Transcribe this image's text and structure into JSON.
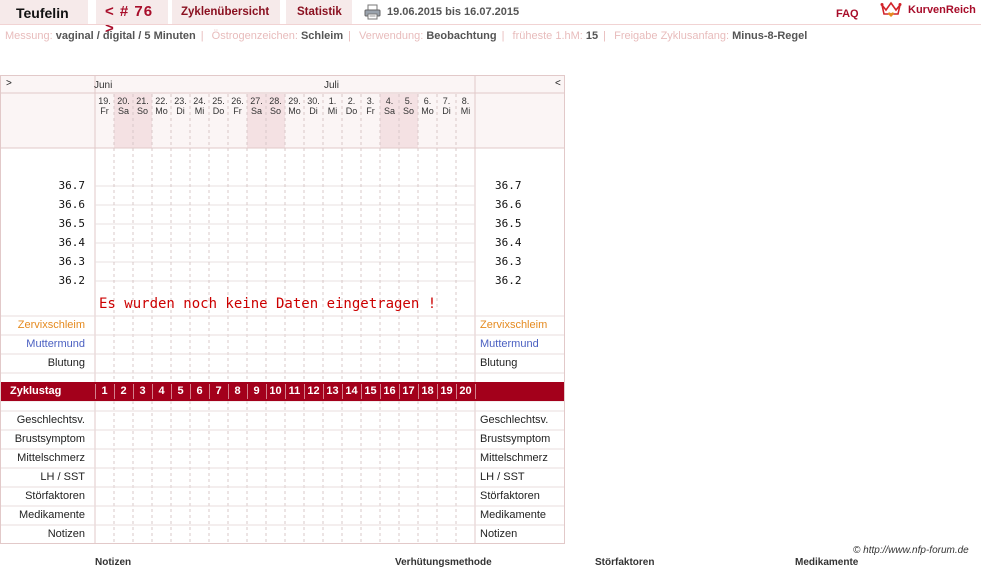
{
  "header": {
    "username": "Teufelin",
    "cycle_nav": "< # 76 >",
    "tab_overview": "Zyklenübersicht",
    "tab_stats": "Statistik",
    "date_range": "19.06.2015 bis 16.07.2015",
    "faq": "FAQ",
    "logo": "KurvenReich",
    "printer_icon": "printer-icon",
    "logo_icon": "crown-heart-icon"
  },
  "meta": {
    "messung_label": "Messung:",
    "messung_value": "vaginal / digital / 5 Minuten",
    "oestrogen_label": "Östrogenzeichen:",
    "oestrogen_value": "Schleim",
    "verwendung_label": "Verwendung:",
    "verwendung_value": "Beobachtung",
    "fruehste_label": "früheste 1.hM:",
    "fruehste_value": "15",
    "freigabe_label": "Freigabe Zyklusanfang:",
    "freigabe_value": "Minus-8-Regel"
  },
  "chart": {
    "nav_left": ">",
    "nav_right": "<",
    "months": [
      "Juni",
      "Juli"
    ],
    "days": [
      {
        "n": "19.",
        "d": "Fr",
        "we": false
      },
      {
        "n": "20.",
        "d": "Sa",
        "we": true
      },
      {
        "n": "21.",
        "d": "So",
        "we": true
      },
      {
        "n": "22.",
        "d": "Mo",
        "we": false
      },
      {
        "n": "23.",
        "d": "Di",
        "we": false
      },
      {
        "n": "24.",
        "d": "Mi",
        "we": false
      },
      {
        "n": "25.",
        "d": "Do",
        "we": false
      },
      {
        "n": "26.",
        "d": "Fr",
        "we": false
      },
      {
        "n": "27.",
        "d": "Sa",
        "we": true
      },
      {
        "n": "28.",
        "d": "So",
        "we": true
      },
      {
        "n": "29.",
        "d": "Mo",
        "we": false
      },
      {
        "n": "30.",
        "d": "Di",
        "we": false
      },
      {
        "n": "1.",
        "d": "Mi",
        "we": false
      },
      {
        "n": "2.",
        "d": "Do",
        "we": false
      },
      {
        "n": "3.",
        "d": "Fr",
        "we": false
      },
      {
        "n": "4.",
        "d": "Sa",
        "we": true
      },
      {
        "n": "5.",
        "d": "So",
        "we": true
      },
      {
        "n": "6.",
        "d": "Mo",
        "we": false
      },
      {
        "n": "7.",
        "d": "Di",
        "we": false
      },
      {
        "n": "8.",
        "d": "Mi",
        "we": false
      }
    ],
    "temp_ticks": [
      "36.7",
      "36.6",
      "36.5",
      "36.4",
      "36.3",
      "36.2"
    ],
    "no_data": "Es wurden noch keine Daten eingetragen !",
    "upper_rows": [
      {
        "label": "Zervixschleim",
        "color": "#e58a1f"
      },
      {
        "label": "Muttermund",
        "color": "#4a5fc1"
      },
      {
        "label": "Blutung",
        "color": "#222222"
      }
    ],
    "cycle_label": "Zyklustag",
    "cycle_days": [
      "1",
      "2",
      "3",
      "4",
      "5",
      "6",
      "7",
      "8",
      "9",
      "10",
      "11",
      "12",
      "13",
      "14",
      "15",
      "16",
      "17",
      "18",
      "19",
      "20"
    ],
    "lower_rows": [
      "Geschlechtsv.",
      "Brustsymptom",
      "Mittelschmerz",
      "LH / SST",
      "Störfaktoren",
      "Medikamente",
      "Notizen"
    ]
  },
  "footer": {
    "credit": "© http://www.nfp-forum.de",
    "bottom_heads": [
      "Notizen",
      "Verhütungsmethode",
      "Störfaktoren",
      "Medikamente"
    ]
  }
}
